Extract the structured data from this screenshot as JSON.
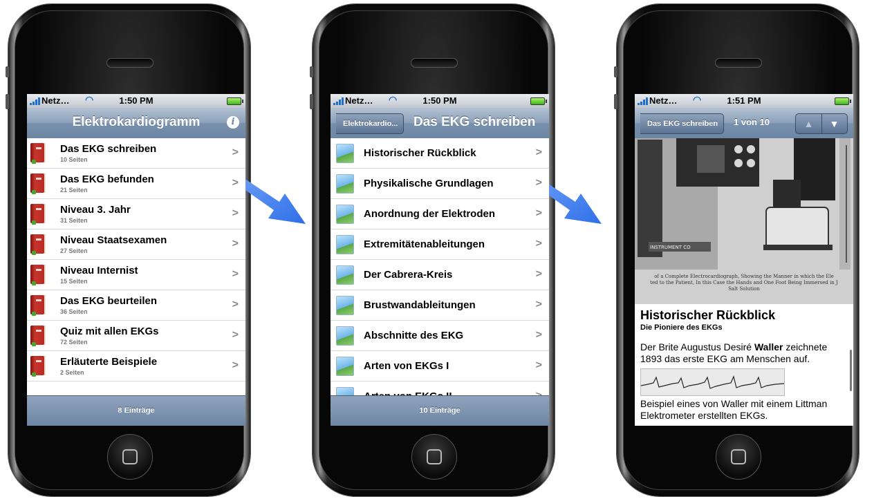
{
  "accent_colors": {
    "nav": "#6d86a4",
    "arrow": "#3b7ef0",
    "book": "#c8352d"
  },
  "status": {
    "carrier": "Netz…"
  },
  "screen1": {
    "time": "1:50 PM",
    "title": "Elektrokardiogramm",
    "info_icon": "i",
    "items": [
      {
        "label": "Das EKG schreiben",
        "sub": "10 Seiten"
      },
      {
        "label": "Das EKG befunden",
        "sub": "21 Seiten"
      },
      {
        "label": "Niveau 3. Jahr",
        "sub": "31 Seiten"
      },
      {
        "label": "Niveau Staatsexamen",
        "sub": "27 Seiten"
      },
      {
        "label": "Niveau Internist",
        "sub": "15 Seiten"
      },
      {
        "label": "Das EKG beurteilen",
        "sub": "36 Seiten"
      },
      {
        "label": "Quiz mit allen EKGs",
        "sub": "72 Seiten"
      },
      {
        "label": "Erläuterte Beispiele",
        "sub": "2 Seiten"
      }
    ],
    "footer": "8 Einträge"
  },
  "screen2": {
    "time": "1:50 PM",
    "back": "Elektrokardio...",
    "title": "Das EKG schreiben",
    "items": [
      {
        "label": "Historischer Rückblick"
      },
      {
        "label": "Physikalische Grundlagen"
      },
      {
        "label": "Anordnung der Elektroden"
      },
      {
        "label": "Extremitätenableitungen"
      },
      {
        "label": "Der Cabrera-Kreis"
      },
      {
        "label": "Brustwandableitungen"
      },
      {
        "label": "Abschnitte des EKG"
      },
      {
        "label": "Arten von EKGs I"
      },
      {
        "label": "Arten von EKGs II"
      }
    ],
    "footer": "10 Einträge"
  },
  "screen3": {
    "time": "1:51 PM",
    "back": "Das EKG schreiben",
    "counter": "1 von 10",
    "nav_up": "▲",
    "nav_down": "▼",
    "caption_line1": "of a Complete Electrocardiograph, Showing the Manner in which the Ele",
    "caption_line2": "ted to the Patient, In this Case the Hands and One Foot Being Immersed in J",
    "caption_line3": "Salt Solution",
    "photo_label": "INSTRUMENT CO",
    "heading": "Historischer Rückblick",
    "subheading": "Die Pioniere des EKGs",
    "para1_a": "Der Brite Augustus Desiré ",
    "para1_bold": "Waller",
    "para1_b": " zeichnete 1893 das erste EKG am Menschen auf.",
    "para2": "Beispiel eines von Waller mit einem Littman Elektrometer erstellten EKGs."
  }
}
